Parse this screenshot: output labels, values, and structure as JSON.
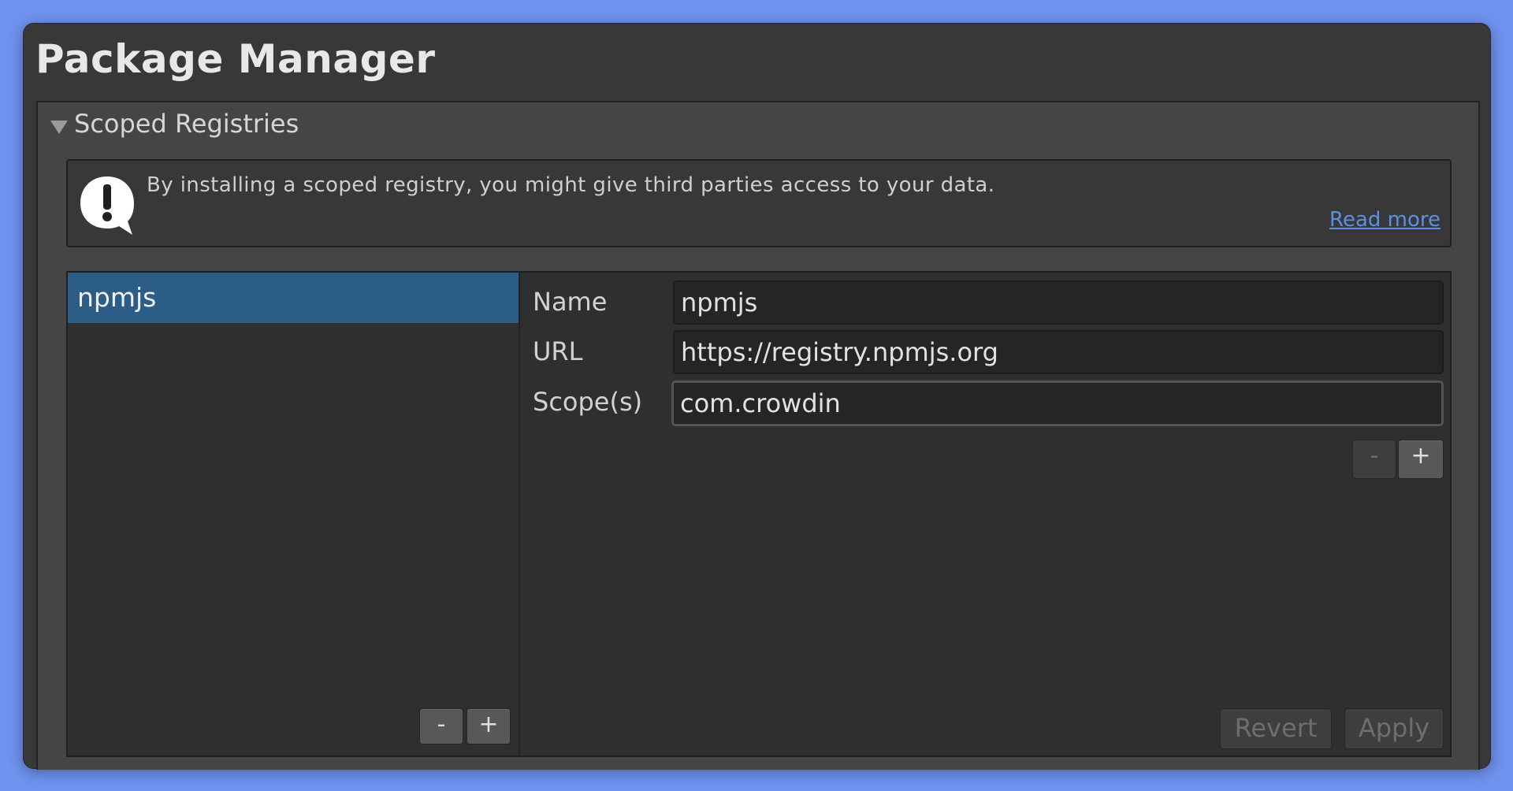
{
  "window": {
    "title": "Package Manager"
  },
  "section": {
    "label": "Scoped Registries"
  },
  "warning": {
    "icon": "exclamation-speech-bubble-icon",
    "text": "By installing a scoped registry, you might give third parties access to your data.",
    "link_label": "Read more"
  },
  "registries": {
    "items": [
      {
        "label": "npmjs"
      }
    ],
    "remove_label": "-",
    "add_label": "+"
  },
  "details": {
    "name_label": "Name",
    "name_value": "npmjs",
    "url_label": "URL",
    "url_value": "https://registry.npmjs.org",
    "scope_label": "Scope(s)",
    "scope_value": "com.crowdin",
    "scope_remove_label": "-",
    "scope_add_label": "+",
    "revert_label": "Revert",
    "apply_label": "Apply"
  },
  "colors": {
    "background": "#6f93ef",
    "window": "#383838",
    "selection": "#2c5d87",
    "link": "#5c8fe6"
  }
}
